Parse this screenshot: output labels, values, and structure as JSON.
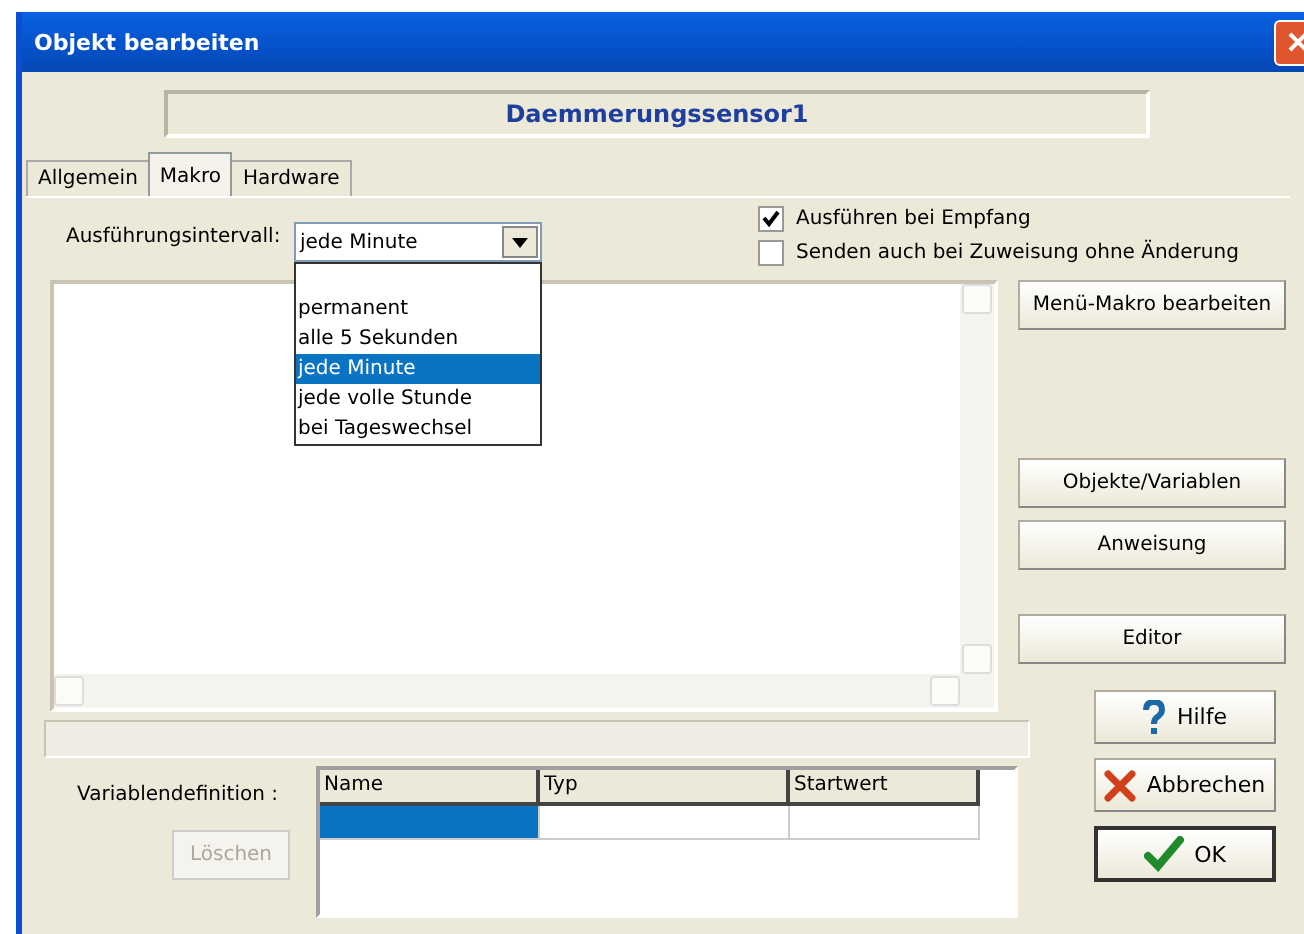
{
  "window": {
    "title": "Objekt bearbeiten"
  },
  "object_name": "Daemmerungssensor1",
  "tabs": [
    {
      "label": "Allgemein",
      "selected": false
    },
    {
      "label": "Makro",
      "selected": true
    },
    {
      "label": "Hardware",
      "selected": false
    }
  ],
  "interval": {
    "label": "Ausführungsintervall:",
    "value": "jede Minute",
    "expanded": true,
    "options": [
      {
        "label": "permanent",
        "selected": false
      },
      {
        "label": "alle 5 Sekunden",
        "selected": false
      },
      {
        "label": "jede Minute",
        "selected": true
      },
      {
        "label": "jede volle Stunde",
        "selected": false
      },
      {
        "label": "bei Tageswechsel",
        "selected": false
      }
    ]
  },
  "checkboxes": [
    {
      "label": "Ausführen bei Empfang",
      "checked": true
    },
    {
      "label": "Senden auch bei Zuweisung ohne Änderung",
      "checked": false
    }
  ],
  "side_buttons": [
    {
      "label": "Menü-Makro bearbeiten"
    },
    {
      "label": "Objekte/Variablen"
    },
    {
      "label": "Anweisung"
    },
    {
      "label": "Editor"
    }
  ],
  "variables": {
    "label": "Variablendefinition :",
    "delete_button": {
      "label": "Löschen",
      "disabled": true
    },
    "columns": [
      "Name",
      "Typ",
      "Startwert"
    ],
    "rows": [
      {
        "selected": true
      }
    ]
  },
  "dialog_buttons": [
    {
      "label": "Hilfe",
      "kind": "help",
      "default": false
    },
    {
      "label": "Abbrechen",
      "kind": "cancel",
      "default": false
    },
    {
      "label": "OK",
      "kind": "ok",
      "default": true
    }
  ]
}
